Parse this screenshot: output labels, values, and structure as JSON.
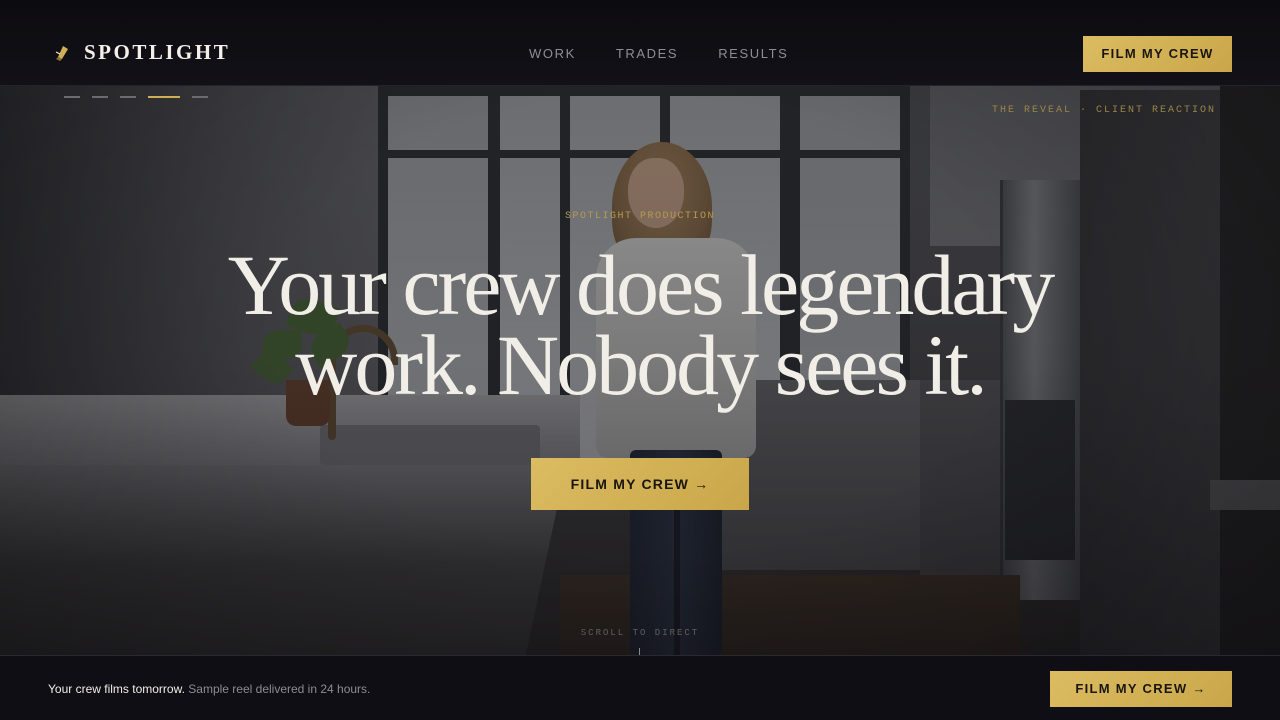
{
  "nav": {
    "brand_name": "SPOTLIGHT",
    "brand_icon": "spotlight-icon",
    "items": [
      {
        "label": "WORK"
      },
      {
        "label": "TRADES"
      },
      {
        "label": "RESULTS"
      }
    ],
    "cta_label": "FILM MY CREW"
  },
  "slides": {
    "count": 5,
    "active_index": 3,
    "caption": "THE REVEAL · CLIENT REACTION"
  },
  "hero": {
    "eyebrow": "SPOTLIGHT PRODUCTION",
    "headline_line1": "Your crew does legendary",
    "headline_line2": "work. Nobody sees it.",
    "cta_label": "FILM MY CREW →",
    "scroll_hint": "SCROLL TO DIRECT"
  },
  "bottom_bar": {
    "lead": "Your crew films tomorrow.",
    "detail": "Sample reel delivered in 24 hours.",
    "cta_label": "FILM MY CREW →"
  },
  "colors": {
    "accent_gold": "#d4b45a",
    "background": "#0e0d12",
    "text_light": "#f1eee8",
    "text_muted": "#8e8c95"
  }
}
